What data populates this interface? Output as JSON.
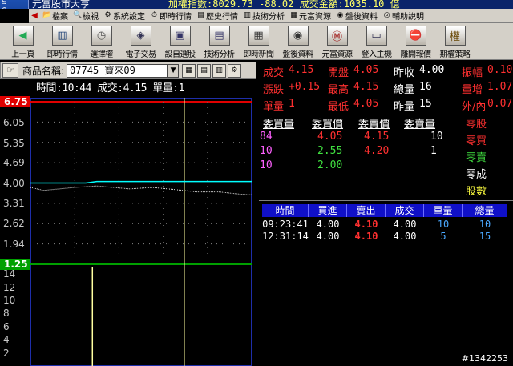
{
  "window": {
    "logo_text": "Source",
    "app_title": "元富股市大亨",
    "ticker_text": "加權指數:8029.73  -88.02  成交金額:1035.10  億"
  },
  "menu": {
    "items": [
      {
        "name": "file",
        "label": "檔案",
        "icon": "📂"
      },
      {
        "name": "view",
        "label": "檢視",
        "icon": "🔍"
      },
      {
        "name": "settings",
        "label": "系統設定",
        "icon": "⚙"
      },
      {
        "name": "realtime",
        "label": "即時行情",
        "icon": "⏱"
      },
      {
        "name": "history",
        "label": "歷史行情",
        "icon": "▤"
      },
      {
        "name": "technical",
        "label": "技術分析",
        "icon": "▥"
      },
      {
        "name": "resources",
        "label": "元富資源",
        "icon": "▦"
      },
      {
        "name": "info",
        "label": "盤後資料",
        "icon": "◉"
      },
      {
        "name": "help",
        "label": "輔助說明",
        "icon": "◎"
      }
    ]
  },
  "toolbar": {
    "items": [
      {
        "name": "prev-page",
        "label": "上一頁",
        "icon": "◀",
        "color": "#2a5"
      },
      {
        "name": "realtime",
        "label": "即時行情",
        "icon": "▥",
        "color": "#247"
      },
      {
        "name": "options",
        "label": "選擇權",
        "icon": "◷",
        "color": "#555"
      },
      {
        "name": "etrade",
        "label": "電子交易",
        "icon": "◈",
        "color": "#335"
      },
      {
        "name": "stock-pick",
        "label": "設自選股",
        "icon": "▣",
        "color": "#336"
      },
      {
        "name": "tech-analysis",
        "label": "技術分析",
        "icon": "▤",
        "color": "#336"
      },
      {
        "name": "news",
        "label": "即時新聞",
        "icon": "▦",
        "color": "#333"
      },
      {
        "name": "after-hours",
        "label": "盤後資料",
        "icon": "◉",
        "color": "#333"
      },
      {
        "name": "resources",
        "label": "元富資源",
        "icon": "Ⓜ",
        "color": "#900"
      },
      {
        "name": "login",
        "label": "登入主機",
        "icon": "▭",
        "color": "#335"
      },
      {
        "name": "exit",
        "label": "離開報價",
        "icon": "⛔",
        "color": "#c00"
      },
      {
        "name": "warrant",
        "label": "期權策略",
        "icon": "權",
        "color": "#640"
      }
    ]
  },
  "selector": {
    "label": "商品名稱:",
    "value": "07745  寶來09",
    "dropdown_glyph": "▼"
  },
  "info": {
    "text": "時間:10:44 成交:4.15 單量:1"
  },
  "price_axis": {
    "ticks": [
      "6.05",
      "5.35",
      "4.69",
      "4.00",
      "3.31",
      "2.62",
      "1.94"
    ],
    "high_box": "6.75",
    "low_box": "1.25",
    "high_color": "#e00000",
    "low_color": "#00a000"
  },
  "volume_axis": {
    "ticks": [
      "14",
      "12",
      "10",
      "8",
      "6",
      "4",
      "2"
    ]
  },
  "chart_data": {
    "type": "line",
    "title": "",
    "xlabel": "",
    "ylabel": "",
    "ylim": [
      1.25,
      6.75
    ],
    "series": [
      {
        "name": "",
        "color": "#00ffff",
        "points": [
          [
            0,
            4.0
          ],
          [
            0.25,
            4.0
          ],
          [
            0.3,
            4.05
          ],
          [
            0.6,
            4.05
          ],
          [
            1.0,
            4.05
          ]
        ]
      },
      {
        "name": "",
        "color": "#e0e0e0",
        "points": [
          [
            0,
            3.85
          ],
          [
            0.06,
            3.75
          ],
          [
            0.2,
            3.85
          ],
          [
            0.3,
            3.9
          ],
          [
            0.45,
            3.8
          ],
          [
            0.55,
            3.85
          ],
          [
            0.65,
            3.78
          ],
          [
            0.75,
            3.7
          ],
          [
            0.85,
            3.7
          ],
          [
            0.95,
            3.62
          ],
          [
            1.0,
            3.6
          ]
        ]
      }
    ],
    "volume_ylim": [
      0,
      15
    ],
    "volume_bars": [
      {
        "x": 0.28,
        "value": 15
      }
    ]
  },
  "quote": {
    "rows": [
      [
        {
          "label": "成交",
          "value": "4.15",
          "lc": "c-red",
          "vc": "c-red"
        },
        {
          "label": "開盤",
          "value": "4.05",
          "lc": "c-red",
          "vc": "c-red"
        },
        {
          "label": "昨收",
          "value": "4.00",
          "lc": "c-white",
          "vc": "c-white"
        },
        {
          "label": "振幅",
          "value": "0.10",
          "lc": "c-red",
          "vc": "c-red"
        }
      ],
      [
        {
          "label": "漲跌",
          "value": "+0.15",
          "lc": "c-red",
          "vc": "c-red"
        },
        {
          "label": "最高",
          "value": "4.15",
          "lc": "c-red",
          "vc": "c-red"
        },
        {
          "label": "總量",
          "value": "16",
          "lc": "c-white",
          "vc": "c-white"
        },
        {
          "label": "量增",
          "value": "1.07",
          "lc": "c-red",
          "vc": "c-red"
        }
      ],
      [
        {
          "label": "單量",
          "value": "1",
          "lc": "c-red",
          "vc": "c-red"
        },
        {
          "label": "最低",
          "value": "4.05",
          "lc": "c-red",
          "vc": "c-red"
        },
        {
          "label": "昨量",
          "value": "15",
          "lc": "c-white",
          "vc": "c-white"
        },
        {
          "label": "外/內",
          "value": "0.07",
          "lc": "c-red",
          "vc": "c-red"
        }
      ]
    ],
    "depth_headers": [
      "委買量",
      "委買價",
      "委賣價",
      "委賣量"
    ],
    "depth_rows": [
      {
        "buy_qty": "84",
        "buy_price": "4.05",
        "sell_price": "4.15",
        "sell_qty": "10"
      },
      {
        "buy_qty": "10",
        "buy_price": "2.55",
        "sell_price": "4.20",
        "sell_qty": "1"
      },
      {
        "buy_qty": "10",
        "buy_price": "2.00",
        "sell_price": "",
        "sell_qty": ""
      }
    ],
    "odd_lot": [
      {
        "label": "零股",
        "color": "#ff3030"
      },
      {
        "label": "零買",
        "color": "#ff3030"
      },
      {
        "label": "零賣",
        "color": "#40e040"
      },
      {
        "label": "零成",
        "color": "#ffffff"
      },
      {
        "label": "股數",
        "color": "#ffff40"
      }
    ]
  },
  "trades": {
    "headers": [
      "時間",
      "買進",
      "賣出",
      "成交",
      "單量",
      "總量"
    ],
    "rows": [
      {
        "time": "09:23:41",
        "bid": "4.00",
        "ask": "4.10",
        "price": "4.00",
        "qty": "10",
        "total": "10"
      },
      {
        "time": "12:31:14",
        "bid": "4.00",
        "ask": "4.10",
        "price": "4.00",
        "qty": "5",
        "total": "15"
      }
    ]
  },
  "footer": {
    "id_text": "#1342253"
  }
}
